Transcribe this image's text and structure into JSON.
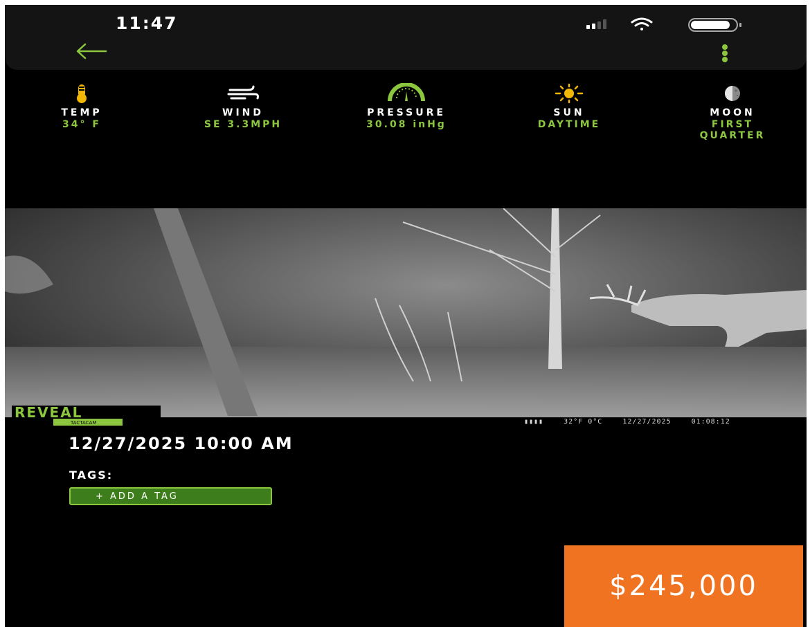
{
  "status_bar": {
    "time": "11:47"
  },
  "weather": {
    "temp": {
      "label": "TEMP",
      "value": "34° F"
    },
    "wind": {
      "label": "WIND",
      "value": "SE 3.3MPH"
    },
    "pressure": {
      "label": "PRESSURE",
      "value": "30.08 inHg"
    },
    "sun": {
      "label": "SUN",
      "value": "DAYTIME"
    },
    "moon": {
      "label": "MOON",
      "value_line1": "FIRST",
      "value_line2": "QUARTER"
    }
  },
  "photo": {
    "brand": "REVEAL",
    "brand_sub": "TACTACAM",
    "stamp_temp": "32°F  0°C",
    "stamp_date": "12/27/2025",
    "stamp_time": "01:08:12"
  },
  "detail": {
    "datetime": "12/27/2025 10:00 AM",
    "tags_label": "TAGS:",
    "add_tag_label": "+ ADD A TAG"
  },
  "price_badge": "$245,000",
  "colors": {
    "accent": "#8cc63f",
    "badge": "#f07321",
    "temp_icon": "#f2b705"
  },
  "icons": [
    "back-arrow-icon",
    "more-vertical-icon",
    "thermometer-icon",
    "wind-icon",
    "pressure-gauge-icon",
    "sun-icon",
    "moon-icon",
    "battery-icon",
    "wifi-icon",
    "signal-icon"
  ]
}
